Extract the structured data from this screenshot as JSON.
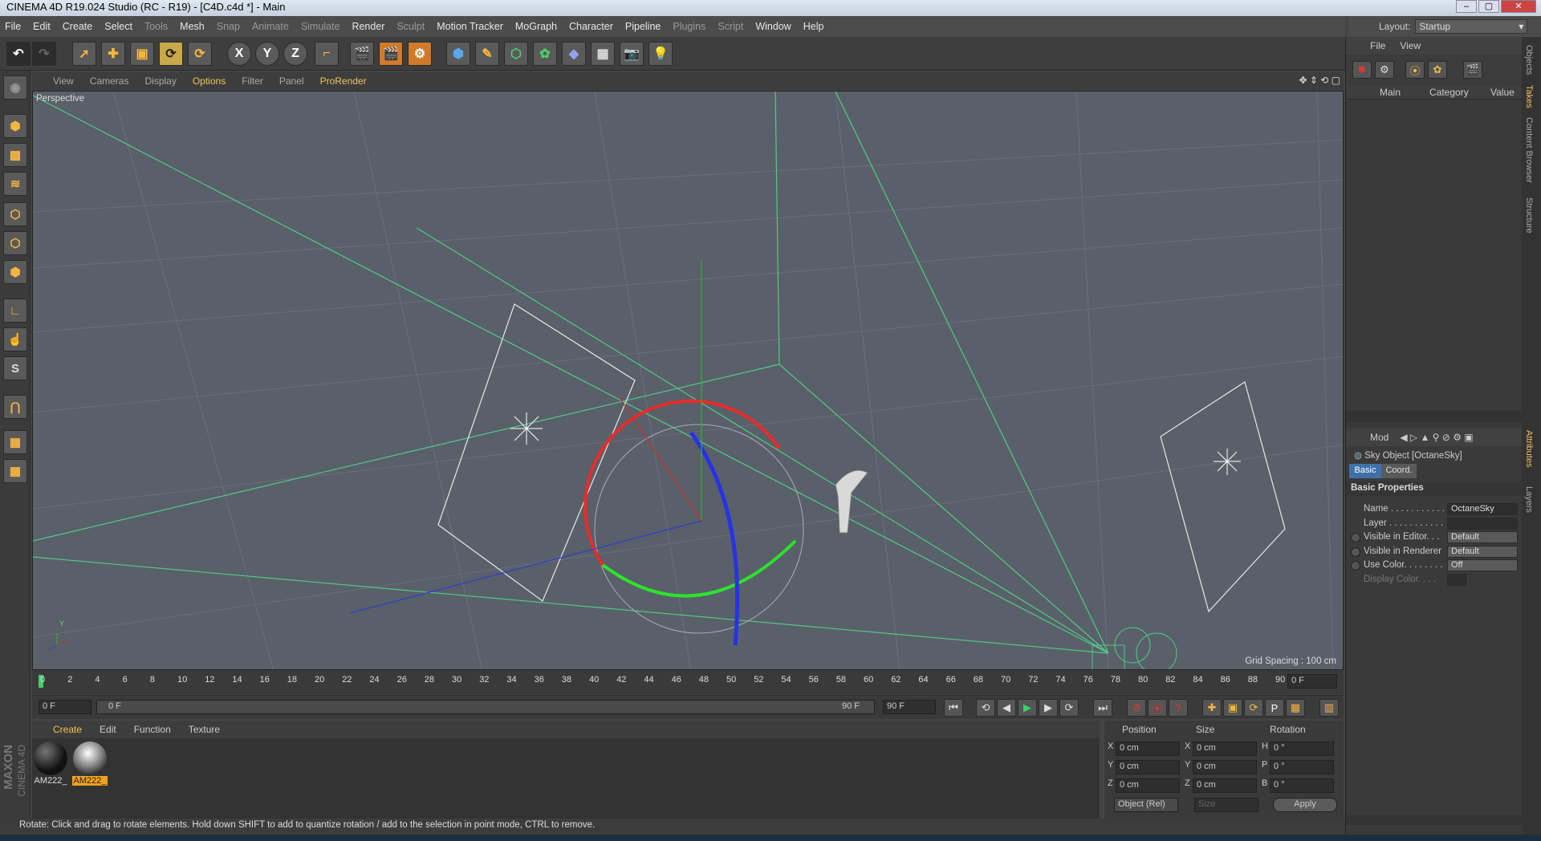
{
  "window": {
    "title": "CINEMA 4D R19.024 Studio (RC - R19) - [C4D.c4d *] - Main",
    "controls": [
      "–",
      "▢",
      "✕"
    ]
  },
  "menu": {
    "items": [
      "File",
      "Edit",
      "Create",
      "Select",
      "Tools",
      "Mesh",
      "Snap",
      "Animate",
      "Simulate",
      "Render",
      "Sculpt",
      "Motion Tracker",
      "MoGraph",
      "Character",
      "Pipeline",
      "Plugins",
      "Script",
      "Window",
      "Help"
    ]
  },
  "layout": {
    "label": "Layout:",
    "value": "Startup"
  },
  "toolbar": {
    "x_label": "X",
    "y_label": "Y",
    "z_label": "Z"
  },
  "viewport": {
    "menu": [
      "View",
      "Cameras",
      "Display",
      "Options",
      "Filter",
      "Panel",
      "ProRender"
    ],
    "label": "Perspective",
    "grid_spacing": "Grid Spacing : 100 cm",
    "axis_y": "Y"
  },
  "timeline": {
    "ticks": [
      "0",
      "2",
      "4",
      "6",
      "8",
      "10",
      "12",
      "14",
      "16",
      "18",
      "20",
      "22",
      "24",
      "26",
      "28",
      "30",
      "32",
      "34",
      "36",
      "38",
      "40",
      "42",
      "44",
      "46",
      "48",
      "50",
      "52",
      "54",
      "56",
      "58",
      "60",
      "62",
      "64",
      "66",
      "68",
      "70",
      "72",
      "74",
      "76",
      "78",
      "80",
      "82",
      "84",
      "86",
      "88",
      "90"
    ],
    "end_field": "0 F",
    "start_field": "0 F",
    "range_start": "0 F",
    "range_end": "90 F",
    "max_field": "90 F"
  },
  "materials": {
    "menu": [
      "Create",
      "Edit",
      "Function",
      "Texture"
    ],
    "items": [
      {
        "label": "AM222_"
      },
      {
        "label": "AM222_"
      }
    ]
  },
  "coords": {
    "headers": {
      "position": "Position",
      "size": "Size",
      "rotation": "Rotation"
    },
    "rows": [
      {
        "axis": "X",
        "pos": "0 cm",
        "saxis": "X",
        "size": "0 cm",
        "raxis": "H",
        "rot": "0 °"
      },
      {
        "axis": "Y",
        "pos": "0 cm",
        "saxis": "Y",
        "size": "0 cm",
        "raxis": "P",
        "rot": "0 °"
      },
      {
        "axis": "Z",
        "pos": "0 cm",
        "saxis": "Z",
        "size": "0 cm",
        "raxis": "B",
        "rot": "0 °"
      }
    ],
    "mode": "Object (Rel)",
    "size_mode": "Size",
    "apply": "Apply"
  },
  "status": "Rotate: Click and drag to rotate elements. Hold down SHIFT to add to quantize rotation / add to the selection in point mode, CTRL to remove.",
  "objects": {
    "menu": [
      "File",
      "View"
    ],
    "cols": {
      "main": "Main",
      "category": "Category",
      "value": "Value"
    }
  },
  "attributes": {
    "mode_label": "Mod",
    "object_title": "Sky Object [OctaneSky]",
    "tabs": [
      "Basic",
      "Coord."
    ],
    "section": "Basic Properties",
    "fields": [
      {
        "label": "Name . . . . . . . . . . .",
        "value": "OctaneSky"
      },
      {
        "label": "Layer . . . . . . . . . . .",
        "value": ""
      },
      {
        "label": "Visible in Editor. . .",
        "value": "Default"
      },
      {
        "label": "Visible in Renderer",
        "value": "Default"
      },
      {
        "label": "Use Color. . . . . . . .",
        "value": "Off"
      },
      {
        "label": "Display Color. . . .",
        "value": ""
      }
    ]
  },
  "side_tabs": [
    "Objects",
    "Takes",
    "Content Browser",
    "Structure",
    "Attributes",
    "Layers"
  ],
  "branding": {
    "maxon": "MAXON",
    "product": "CINEMA 4D"
  }
}
